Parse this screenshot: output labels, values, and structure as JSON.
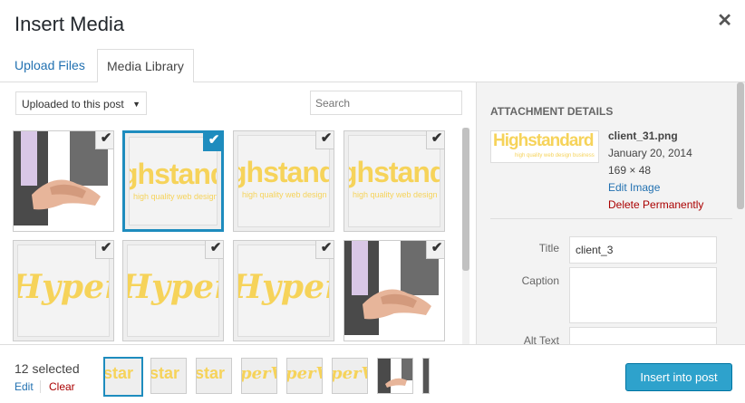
{
  "modal": {
    "title": "Insert Media",
    "close_icon": "✕"
  },
  "tabs": [
    {
      "label": "Upload Files"
    },
    {
      "label": "Media Library"
    }
  ],
  "browser": {
    "filter": {
      "label": "Uploaded to this post",
      "arrow": "▼"
    },
    "search": {
      "placeholder": "Search"
    },
    "attachments": [
      {
        "kind": "photo",
        "checked": true
      },
      {
        "kind": "highstandard",
        "text": "ghstandard",
        "tag": "high quality web design",
        "checked": true,
        "current": true
      },
      {
        "kind": "highstandard",
        "text": "ghstandard",
        "tag": "high quality web design",
        "checked": true
      },
      {
        "kind": "highstandard",
        "text": "ghstandard",
        "tag": "high quality web design",
        "checked": true
      },
      {
        "kind": "hyperweb",
        "text": "HyperWe",
        "checked": true
      },
      {
        "kind": "hyperweb",
        "text": "HyperWe",
        "checked": true
      },
      {
        "kind": "hyperweb",
        "text": "HyperWe",
        "checked": true
      },
      {
        "kind": "photo",
        "checked": true
      }
    ],
    "check_glyph": "✔"
  },
  "details": {
    "heading": "Attachment Details",
    "thumb_text": "Highstandard",
    "thumb_tag": "high quality web design business",
    "filename": "client_31.png",
    "date": "January 20, 2014",
    "dimensions": "169 × 48",
    "edit_link": "Edit Image",
    "delete_link": "Delete Permanently",
    "fields": {
      "title_label": "Title",
      "title_value": "client_3",
      "caption_label": "Caption",
      "caption_value": "",
      "alt_label": "Alt Text",
      "alt_value": ""
    }
  },
  "toolbar": {
    "selected_count": "12 selected",
    "edit_label": "Edit",
    "clear_label": "Clear",
    "minis": [
      {
        "kind": "hs",
        "text": "star"
      },
      {
        "kind": "hs",
        "text": "star"
      },
      {
        "kind": "hs",
        "text": "star"
      },
      {
        "kind": "hw",
        "text": "perV"
      },
      {
        "kind": "hw",
        "text": "perV"
      },
      {
        "kind": "hw",
        "text": "perV"
      },
      {
        "kind": "photo",
        "text": ""
      },
      {
        "kind": "partial",
        "text": ""
      }
    ],
    "insert_label": "Insert into post"
  }
}
